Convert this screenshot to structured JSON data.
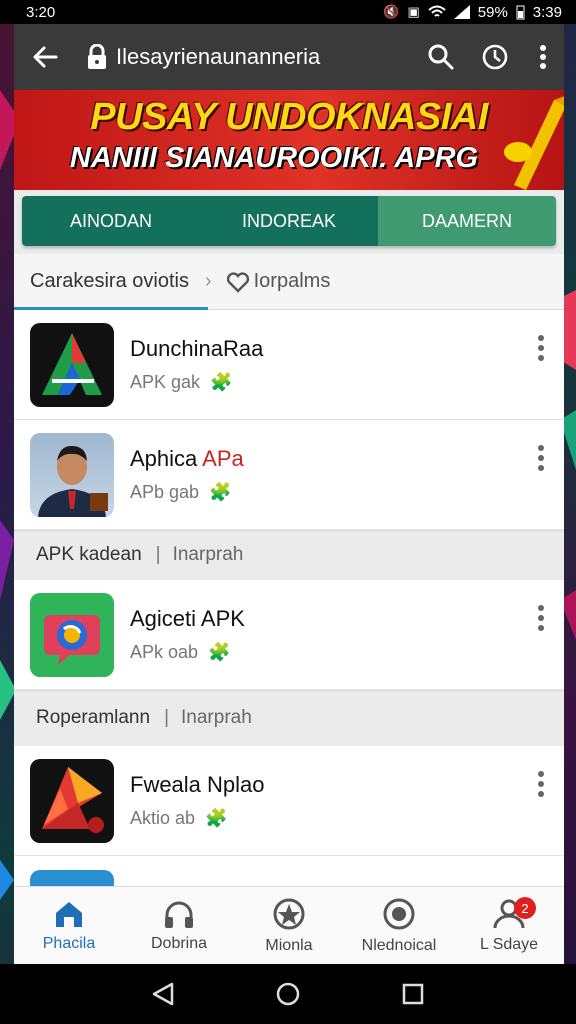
{
  "status": {
    "time": "3:20",
    "battery": "59%",
    "clock": "3:39"
  },
  "appbar": {
    "url": "Ilesayrienaunanneria",
    "icons": [
      "back-arrow-icon",
      "lock-icon",
      "search-icon",
      "timer-icon",
      "more-vert-icon"
    ]
  },
  "banner": {
    "title": "PUSAY UNDOKNASIAI",
    "subtitle": "NANIII SIANAUROOIKI. APRG"
  },
  "tabs": [
    {
      "label": "AINODAN",
      "active": false
    },
    {
      "label": "INDOREAK",
      "active": false
    },
    {
      "label": "DAAMERN",
      "active": true
    }
  ],
  "breadcrumb": {
    "first": "Carakesira oviotis",
    "second": "Iorpalms"
  },
  "colors": {
    "tab": "#13705a",
    "tab_active": "#3f9a72",
    "banner": "#d8241c",
    "accent_blue": "#1f6fb8"
  },
  "items": [
    {
      "name": "DunchinaRaa",
      "name_accent": "",
      "meta": "APK gak"
    },
    {
      "name": "Aphica ",
      "name_accent": "APa",
      "meta": "APb gab"
    },
    {
      "name": "Agiceti APK",
      "name_accent": "",
      "meta": "APk oab"
    },
    {
      "name": "Fweala Nplao",
      "name_accent": "",
      "meta": "Aktio ab"
    }
  ],
  "sections": [
    {
      "left": "APK  kadean",
      "right": "Inarprah"
    },
    {
      "left": "Roperamlann",
      "right": "Inarprah"
    }
  ],
  "bottom_nav": [
    {
      "label": "Phacila",
      "icon": "home-icon",
      "active": true
    },
    {
      "label": "Dobrina",
      "icon": "headphones-icon",
      "active": false
    },
    {
      "label": "Mionla",
      "icon": "star-badge-icon",
      "active": false
    },
    {
      "label": "Nlednoical",
      "icon": "target-icon",
      "active": false
    },
    {
      "label": "L Sdaye",
      "icon": "user-icon",
      "active": false,
      "badge": "2"
    }
  ]
}
